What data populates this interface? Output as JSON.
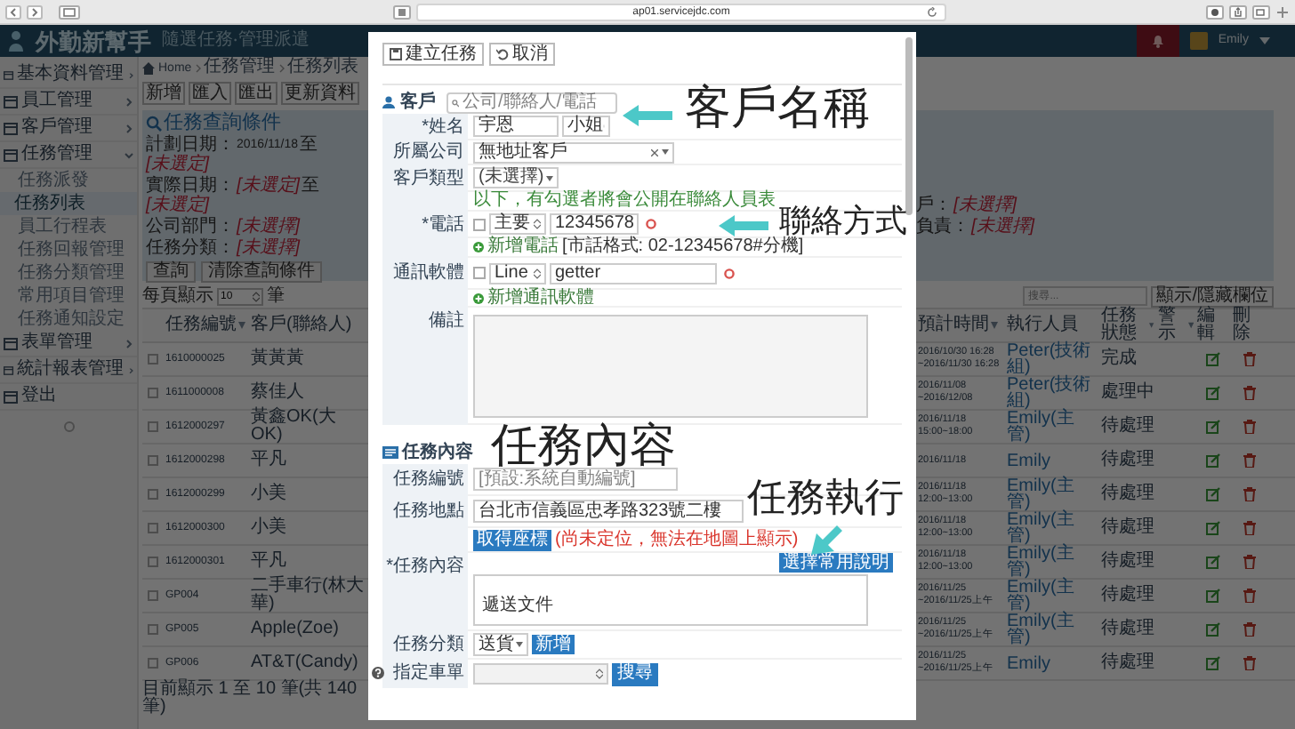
{
  "browser": {
    "url": "ap01.servicejdc.com"
  },
  "header": {
    "logo": "外勤新幫手",
    "tagline": "隨選任務‧管理派遣",
    "user": "Emily"
  },
  "sidebar": {
    "items": [
      {
        "label": "基本資料管理",
        "expanded": false
      },
      {
        "label": "員工管理",
        "expanded": false
      },
      {
        "label": "客戶管理",
        "expanded": false
      },
      {
        "label": "任務管理",
        "expanded": true,
        "children": [
          {
            "label": "任務派發",
            "selected": false
          },
          {
            "label": "任務列表",
            "selected": true
          },
          {
            "label": "員工行程表",
            "selected": false
          },
          {
            "label": "任務回報管理",
            "selected": false
          },
          {
            "label": "任務分類管理",
            "selected": false
          },
          {
            "label": "常用項目管理",
            "selected": false
          },
          {
            "label": "任務通知設定",
            "selected": false
          }
        ]
      },
      {
        "label": "表單管理",
        "expanded": false
      },
      {
        "label": "統計報表管理",
        "expanded": false
      },
      {
        "label": "登出"
      }
    ]
  },
  "breadcrumb": [
    "Home",
    "任務管理",
    "任務列表"
  ],
  "toolbar": [
    "新增",
    "匯入",
    "匯出",
    "更新資料"
  ],
  "filter": {
    "title": "任務查詢條件",
    "lines": [
      [
        {
          "kind": "label",
          "text": "計劃日期："
        },
        {
          "kind": "date",
          "text": "2016/11/18"
        },
        {
          "kind": "label",
          "text": "至"
        },
        {
          "kind": "value",
          "text": "[未選定]"
        }
      ],
      [
        {
          "kind": "label",
          "text": "實際日期："
        },
        {
          "kind": "value",
          "text": "[未選定]"
        },
        {
          "kind": "label",
          "text": "至"
        },
        {
          "kind": "value",
          "text": "[未選定]"
        }
      ],
      [
        {
          "kind": "label",
          "text": "公司部門："
        },
        {
          "kind": "value",
          "text": "[未選擇]"
        }
      ],
      [
        {
          "kind": "label",
          "text": "任務分類："
        },
        {
          "kind": "value",
          "text": "[未選擇]"
        }
      ]
    ],
    "right_lines": [
      [
        {
          "kind": "label",
          "text": "戶："
        },
        {
          "kind": "value",
          "text": "[未選擇]"
        }
      ],
      [
        {
          "kind": "label",
          "text": "負責："
        },
        {
          "kind": "value",
          "text": "[未選擇]"
        }
      ]
    ],
    "buttons": [
      "查詢",
      "清除查詢條件"
    ]
  },
  "page_size": {
    "before": "每頁顯示",
    "value": "10",
    "after": "筆"
  },
  "search": {
    "placeholder": "搜尋...",
    "button": "顯示/隱藏欄位"
  },
  "table": {
    "columns": [
      {
        "label": "任務編號",
        "sortable": true
      },
      {
        "label": "客戶(聯絡人)",
        "sortable": false
      },
      {
        "label": "預計時間",
        "sortable": true
      },
      {
        "label": "執行人員",
        "sortable": false
      },
      {
        "label": "任務狀態",
        "sortable": true
      },
      {
        "label": "警示",
        "sortable": true
      },
      {
        "label": "編輯",
        "sortable": false
      },
      {
        "label": "刪除",
        "sortable": false
      }
    ],
    "rows": [
      {
        "checked": false,
        "id": "1610000025",
        "client": "黃黃黃",
        "time": [
          "2016/10/30 16:28",
          "~2016/11/30 16:28"
        ],
        "executor": "Peter(技術組)",
        "status": "完成"
      },
      {
        "checked": false,
        "id": "1611000008",
        "client": "蔡佳人",
        "time": [
          "2016/11/08",
          "~2016/12/08"
        ],
        "executor": "Peter(技術組)",
        "status": "處理中"
      },
      {
        "checked": false,
        "id": "1612000297",
        "client": "黃鑫OK(大OK)",
        "time": [
          "2016/11/18",
          "15:00~18:00"
        ],
        "executor": "Emily(主管)",
        "status": "待處理"
      },
      {
        "checked": false,
        "id": "1612000298",
        "client": "平凡",
        "time": [
          "2016/11/18"
        ],
        "executor": "Emily",
        "status": "待處理"
      },
      {
        "checked": false,
        "id": "1612000299",
        "client": "小美",
        "time": [
          "2016/11/18",
          "12:00~13:00"
        ],
        "executor": "Emily(主管)",
        "status": "待處理"
      },
      {
        "checked": false,
        "id": "1612000300",
        "client": "小美",
        "time": [
          "2016/11/18",
          "12:00~13:00"
        ],
        "executor": "Emily(主管)",
        "status": "待處理"
      },
      {
        "checked": false,
        "id": "1612000301",
        "client": "平凡",
        "time": [
          "2016/11/18",
          "12:00~13:00"
        ],
        "executor": "Emily(主管)",
        "status": "待處理"
      },
      {
        "checked": false,
        "id": "GP004",
        "client": "二手車行(林大華)",
        "time": [
          "2016/11/25",
          "~2016/11/25上午"
        ],
        "executor": "Emily(主管)",
        "status": "待處理"
      },
      {
        "checked": false,
        "id": "GP005",
        "client": "Apple(Zoe)",
        "time": [
          "2016/11/25",
          "~2016/11/25上午"
        ],
        "executor": "Emily(主管)",
        "status": "待處理"
      },
      {
        "checked": false,
        "id": "GP006",
        "client": "AT&T(Candy)",
        "time": [
          "2016/11/25",
          "~2016/11/25上午"
        ],
        "executor": "Emily",
        "status": "待處理"
      }
    ],
    "footer": "目前顯示 1 至 10 筆(共 140 筆)"
  },
  "modal": {
    "buttons": [
      {
        "label": "建立任務"
      },
      {
        "label": "取消"
      }
    ],
    "customer_section": {
      "title": "客戶",
      "search_placeholder": "公司/聯絡人/電話"
    },
    "name": {
      "label": "*姓名",
      "value": "宇恩",
      "title": "小姐"
    },
    "company": {
      "label": "所屬公司",
      "value": "無地址客戶"
    },
    "customer_type": {
      "label": "客戶類型",
      "value": "(未選擇)"
    },
    "contact_hint": "以下，有勾選者將會公開在聯絡人員表",
    "phone": {
      "label": "*電話",
      "checked": false,
      "type": "主要",
      "value": "12345678",
      "add_label": "新增電話",
      "format_hint": "[市話格式: 02-12345678#分機]"
    },
    "messenger": {
      "label": "通訊軟體",
      "checked": false,
      "type": "Line",
      "value": "getter",
      "add_label": "新增通訊軟體"
    },
    "note": {
      "label": "備註"
    },
    "task_section": {
      "title": "任務內容"
    },
    "task_number": {
      "label": "任務編號",
      "placeholder": "[預設:系統自動編號]"
    },
    "task_location": {
      "label": "任務地點",
      "value": "台北市信義區忠孝路323號二樓",
      "button": "取得座標",
      "status": "(尚未定位，無法在地圖上顯示)"
    },
    "task_content": {
      "label": "*任務內容",
      "button": "選擇常用說明",
      "value": "遞送文件"
    },
    "task_category": {
      "label": "任務分類",
      "value": "送貨",
      "button": "新增"
    },
    "assign": {
      "label": "指定車單",
      "button": "搜尋"
    }
  },
  "annotations": [
    {
      "text": "客戶名稱",
      "kind": "left"
    },
    {
      "text": "聯絡方式",
      "kind": "left"
    },
    {
      "text": "任務內容",
      "kind": "plain"
    },
    {
      "text": "任務執行",
      "kind": "down"
    }
  ]
}
